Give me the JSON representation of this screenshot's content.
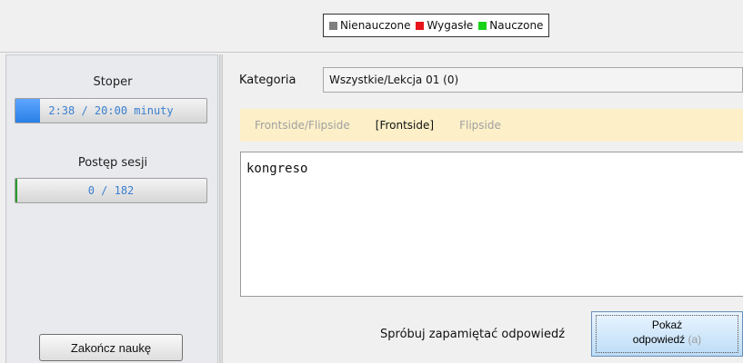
{
  "legend": {
    "items": [
      {
        "label": "Nienauczone",
        "color": "#7f7f7f"
      },
      {
        "label": "Wygasłe",
        "color": "#e8141c"
      },
      {
        "label": "Nauczone",
        "color": "#19d319"
      }
    ]
  },
  "left_panel": {
    "timer_label": "Stoper",
    "timer_text": "2:38 / 20:00 minuty",
    "timer_progress": 0.13,
    "session_label": "Postęp sesji",
    "session_text": "0 / 182",
    "session_progress": 0.0,
    "end_button": "Zakończ naukę"
  },
  "main": {
    "category_label": "Kategoria",
    "category_value": "Wszystkie/Lekcja 01 (0)",
    "tabs": [
      {
        "label": "Frontside/Flipside"
      },
      {
        "label": "[Frontside]"
      },
      {
        "label": "Flipside"
      }
    ],
    "card_text": "kongreso",
    "hint": "Spróbuj zapamiętać odpowiedź",
    "show_button": {
      "line1": "Pokaż",
      "line2": "odpowiedź",
      "shortcut": "(a)"
    }
  },
  "colors": {
    "tab_bar_bg": "#fdf0c8",
    "progress_fill": "#2a7fe6",
    "progress_text": "#3a7fd0"
  }
}
